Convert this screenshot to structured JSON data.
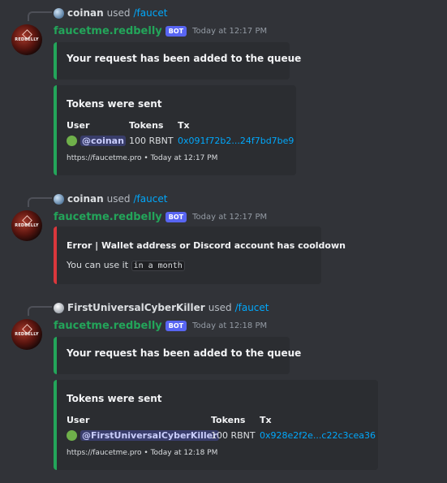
{
  "messages": [
    {
      "reply": {
        "user": "coinan",
        "used": "used",
        "command": "/faucet"
      },
      "bot": {
        "name": "faucetme.redbelly",
        "tag": "BOT",
        "time": "Today at 12:17 PM",
        "avatar_text": "REDBELLY"
      },
      "queue_embed": {
        "title": "Your request has been added to the queue"
      },
      "tokens_embed": {
        "title": "Tokens were sent",
        "user_label": "User",
        "user_value": "@coinan",
        "tokens_label": "Tokens",
        "tokens_value": "100 RBNT",
        "tx_label": "Tx",
        "tx_value": "0x091f72b2...24f7bd7be9",
        "footer": "https://faucetme.pro • Today at 12:17 PM"
      }
    },
    {
      "reply": {
        "user": "coinan",
        "used": "used",
        "command": "/faucet"
      },
      "bot": {
        "name": "faucetme.redbelly",
        "tag": "BOT",
        "time": "Today at 12:17 PM",
        "avatar_text": "REDBELLY"
      },
      "error_embed": {
        "title": "Error | Wallet address or Discord account has cooldown",
        "desc_prefix": "You can use it",
        "desc_code": "in a month"
      }
    },
    {
      "reply": {
        "user": "FirstUniversalCyberKiller",
        "used": "used",
        "command": "/faucet"
      },
      "bot": {
        "name": "faucetme.redbelly",
        "tag": "BOT",
        "time": "Today at 12:18 PM",
        "avatar_text": "REDBELLY"
      },
      "queue_embed": {
        "title": "Your request has been added to the queue"
      },
      "tokens_embed": {
        "title": "Tokens were sent",
        "user_label": "User",
        "user_value": "@FirstUniversalCyberKiller",
        "tokens_label": "Tokens",
        "tokens_value": "100 RBNT",
        "tx_label": "Tx",
        "tx_value": "0x928e2f2e...c22c3cea36",
        "footer": "https://faucetme.pro • Today at 12:18 PM"
      }
    }
  ],
  "colors": {
    "background": "#313338",
    "embed_bg": "#2b2d31",
    "success_accent": "#23a55a",
    "error_accent": "#da373c",
    "link": "#00a8fc",
    "bot_tag": "#5865f2"
  },
  "icons": {
    "reply_avatar": "user-avatar-icon",
    "status": "online-status-icon",
    "bot_avatar": "redbelly-logo-icon"
  }
}
